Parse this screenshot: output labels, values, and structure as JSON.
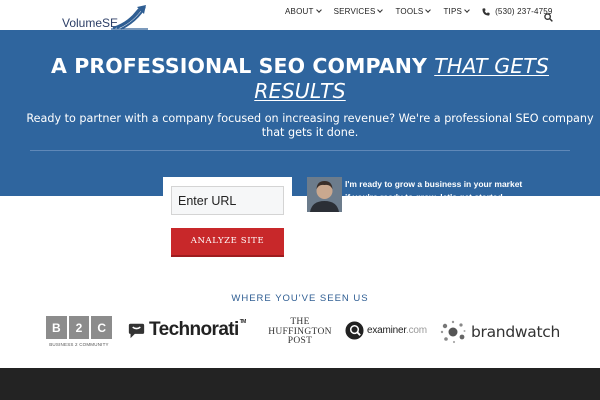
{
  "header": {
    "logo_text": "VolumeSE",
    "nav": [
      {
        "label": "ABOUT"
      },
      {
        "label": "SERVICES"
      },
      {
        "label": "TOOLS"
      },
      {
        "label": "TIPS"
      }
    ],
    "phone": "(530) 237-4759",
    "icons": {
      "phone": "phone-icon",
      "search": "search-icon",
      "chevron": "chevron-down-icon"
    }
  },
  "hero": {
    "title_main": "A PROFESSIONAL SEO COMPANY",
    "title_emphasis_1": "THAT GETS",
    "title_emphasis_2": "RESULTS",
    "subtitle": "Ready to partner with a company focused on increasing revenue? We're a professional SEO company that gets it done.",
    "background_color": "#2f659e"
  },
  "form": {
    "url_placeholder": "Enter URL",
    "url_value": "",
    "analyze_label": "ANALYZE SITE",
    "button_color": "#c8282a"
  },
  "testimonial": {
    "line1": "I'm ready to grow a business in your market",
    "line2": "if you're ready to grow, let's get started"
  },
  "seen_us": {
    "title": "WHERE YOU'VE SEEN US",
    "b2c": {
      "letters": [
        "B",
        "2",
        "C"
      ],
      "caption": "BUSINESS 2 COMMUNITY"
    },
    "technorati": "Technorati",
    "technorati_tm": "TM",
    "huffington": [
      "THE",
      "HUFFINGTON",
      "POST"
    ],
    "examiner": "examiner",
    "examiner_suffix": ".com",
    "brandwatch": "brandwatch"
  }
}
